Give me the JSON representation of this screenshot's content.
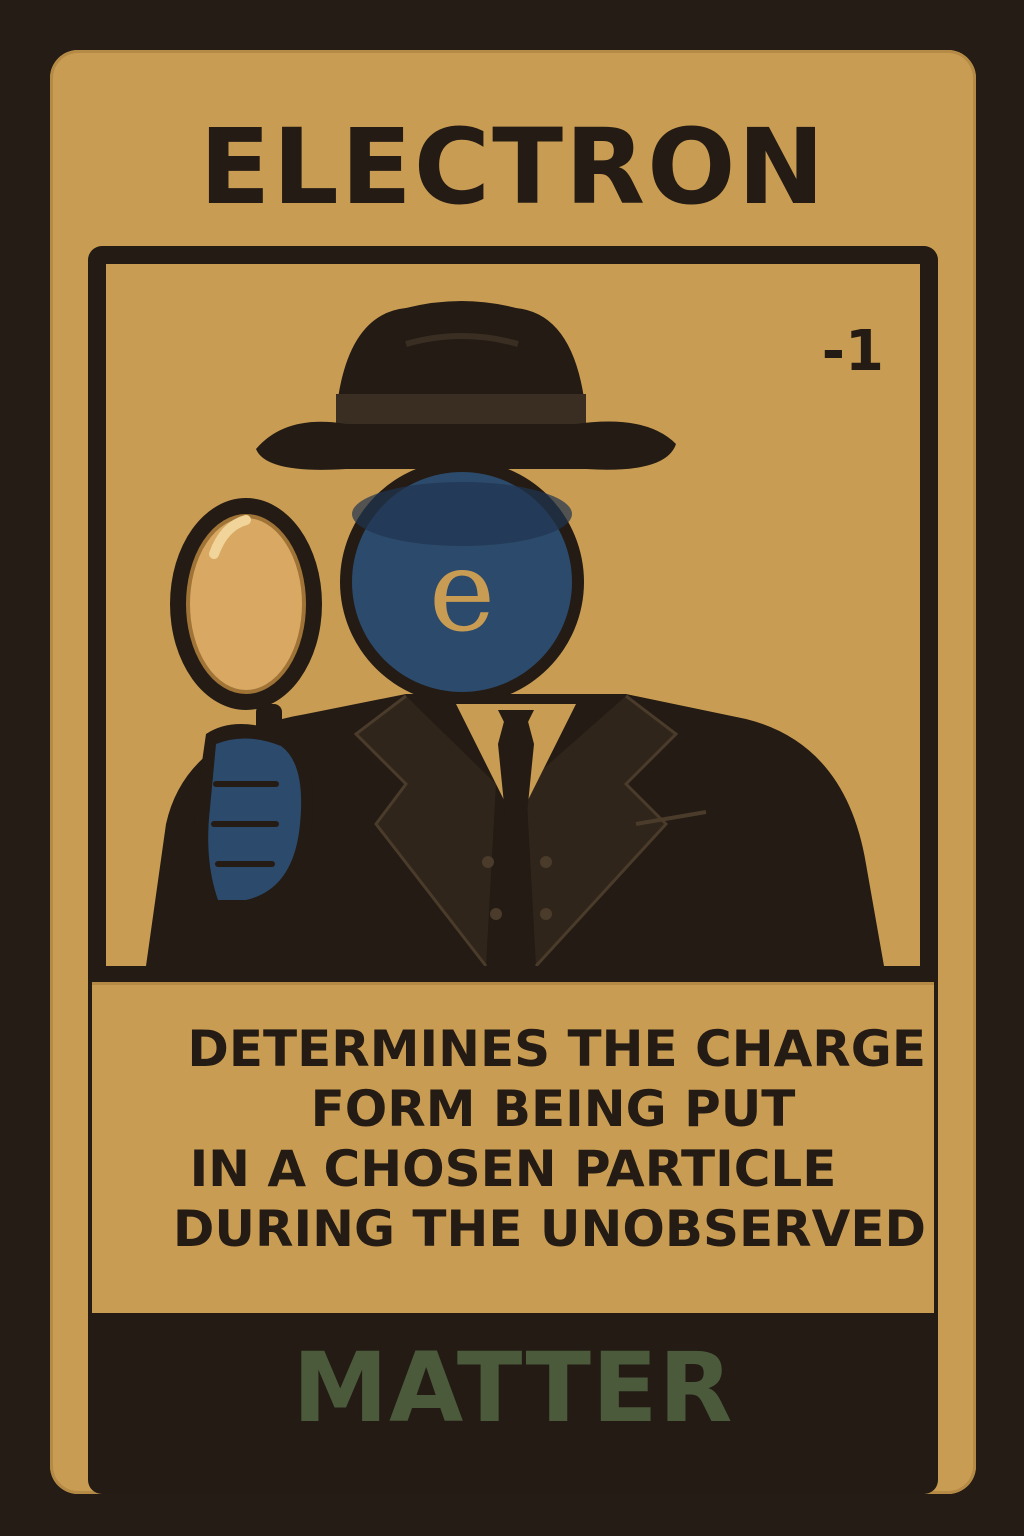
{
  "card": {
    "title": "ELECTRON",
    "charge": "-1",
    "face_letter": "e",
    "ability_lines": [
      "DETERMINES THE CHARGE",
      "FORM BEING PUT",
      "IN A CHOSEN PARTICLE",
      "DURING THE UNOBSERVED"
    ],
    "type": "MATTER"
  },
  "colors": {
    "card_background": "#c99c53",
    "frame": "#231b14",
    "face": "#2c4a6b",
    "type_text": "#4b5a3b"
  },
  "icons": {
    "illustration": "detective-electron-illustration",
    "magnifier": "magnifying-glass-icon",
    "hat": "fedora-hat-icon"
  }
}
